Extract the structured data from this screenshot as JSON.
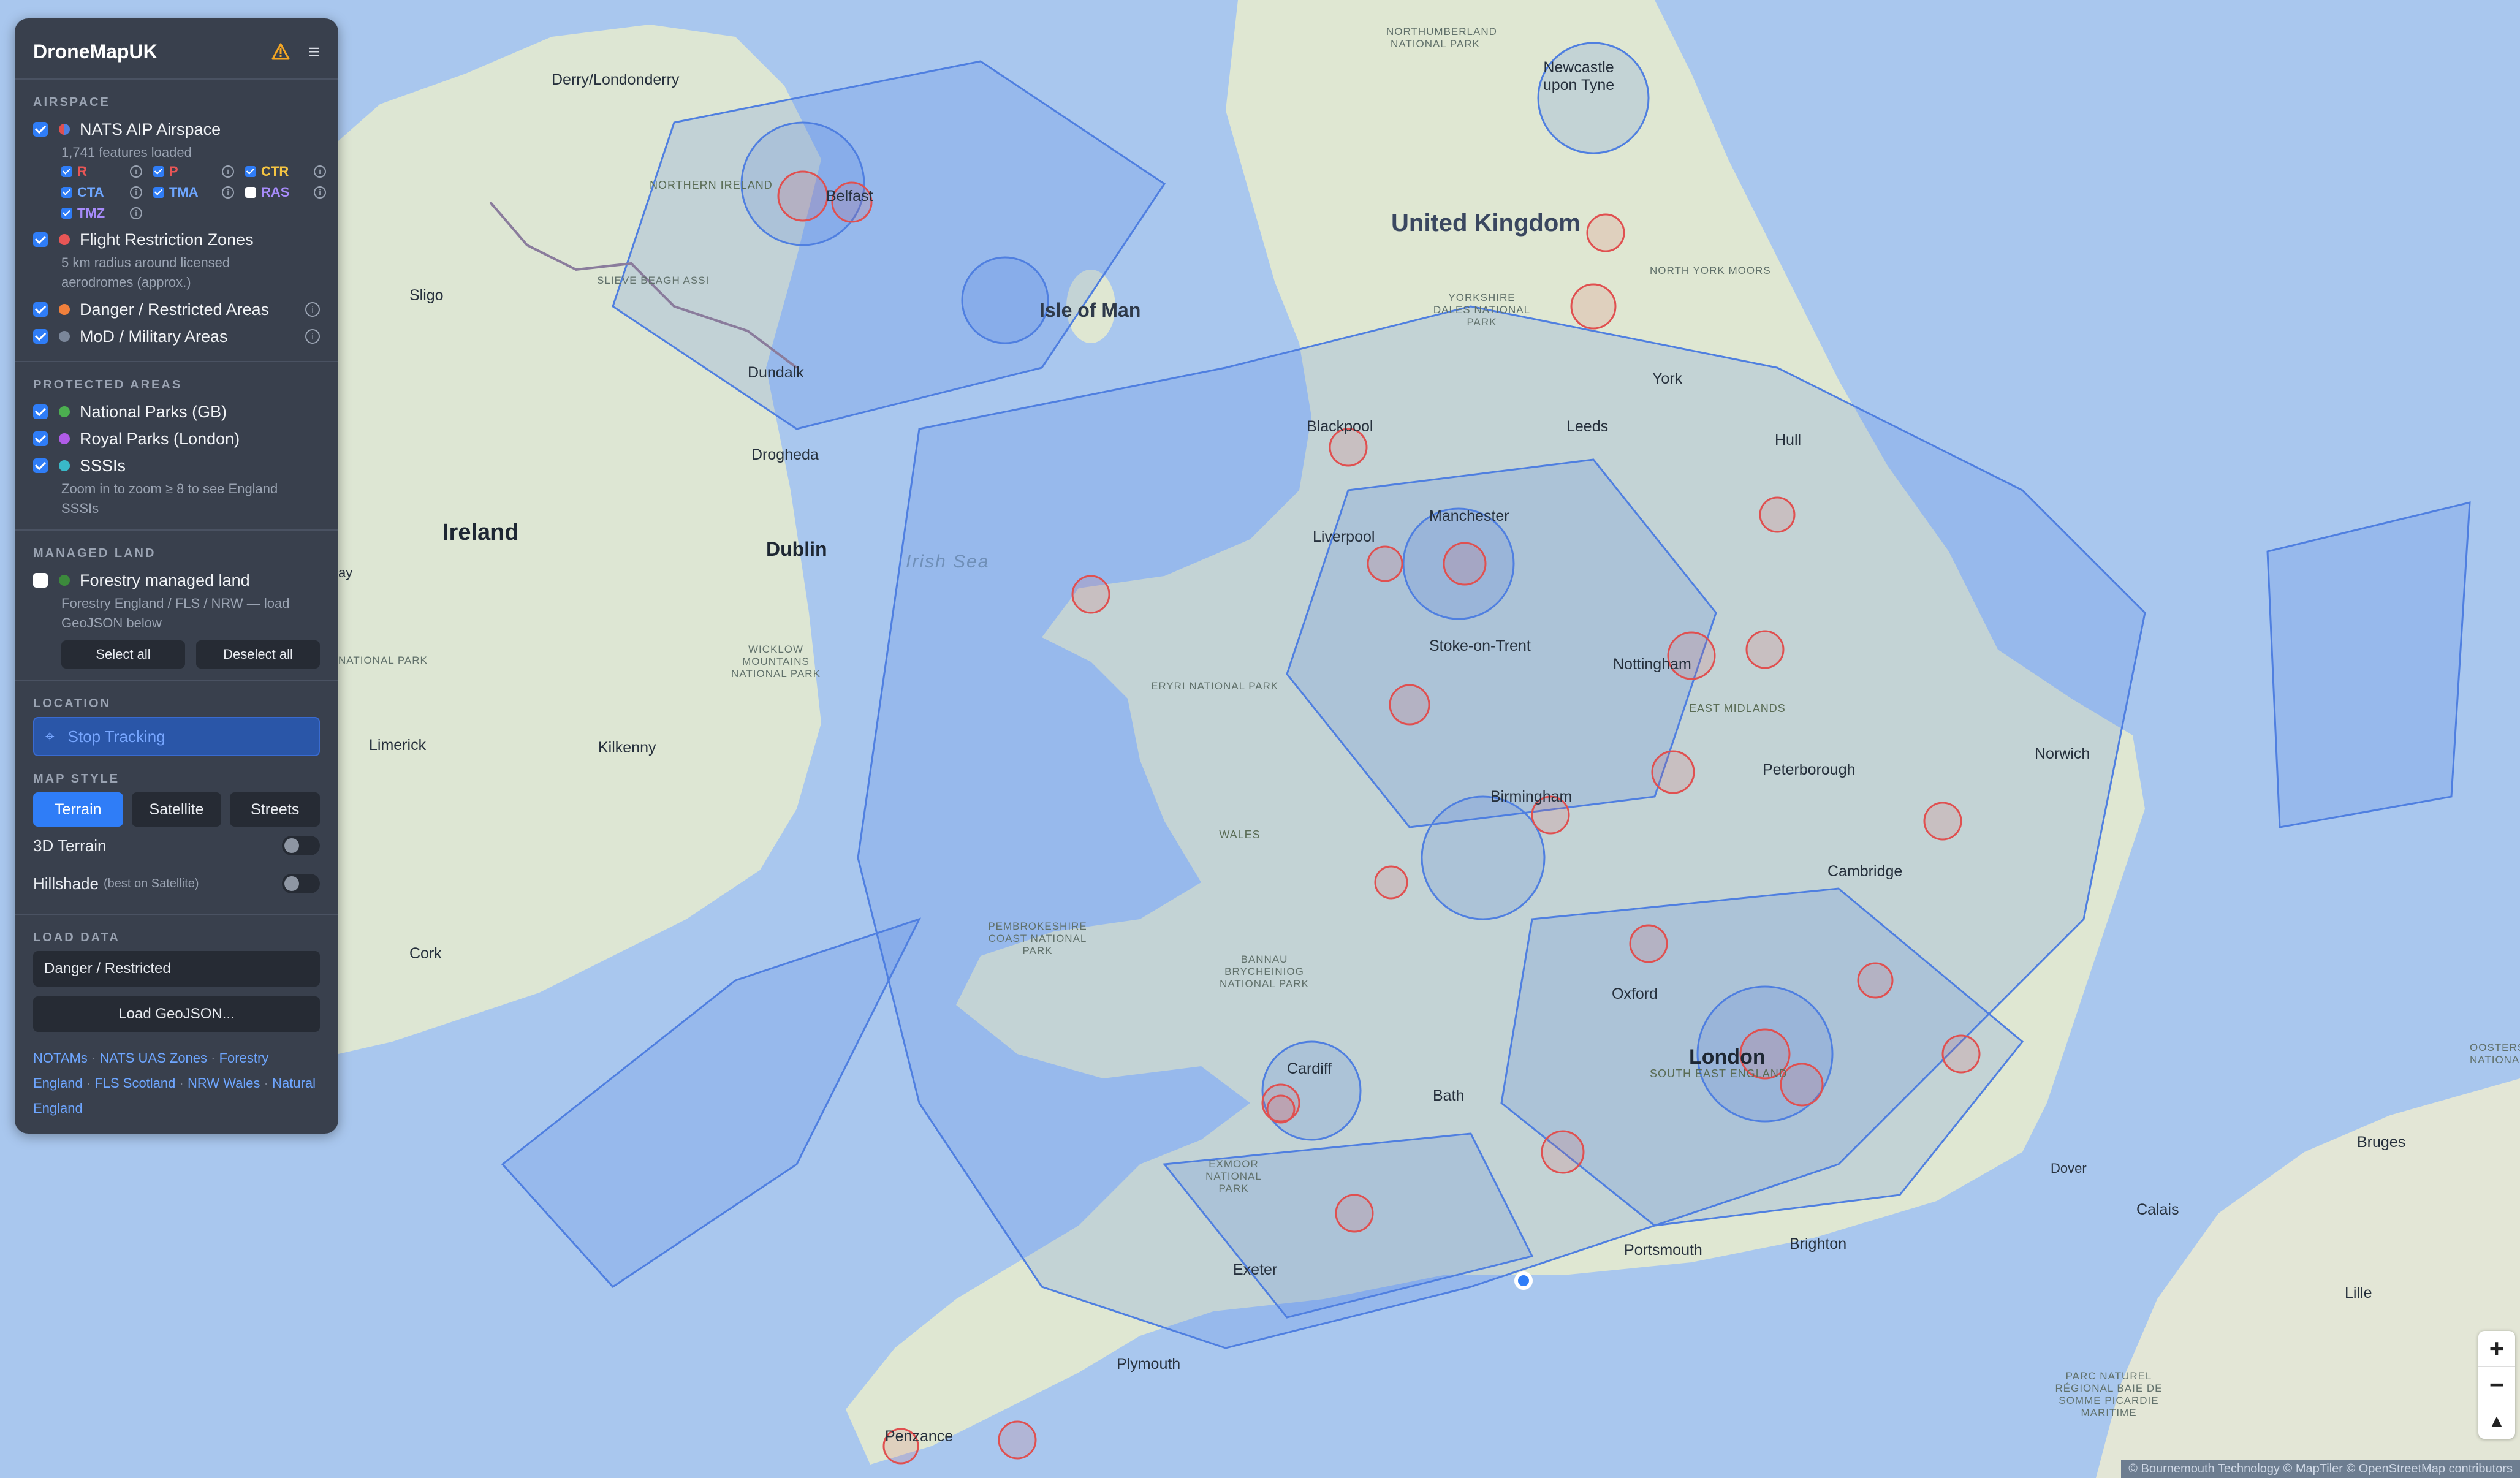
{
  "app": {
    "title": "DroneMapUK"
  },
  "panel": {
    "airspace_header": "AIRSPACE",
    "nats_label": "NATS AIP Airspace",
    "nats_note": "1,741 features loaded",
    "sub_r": "R",
    "sub_p": "P",
    "sub_ctr": "CTR",
    "sub_cta": "CTA",
    "sub_tma": "TMA",
    "sub_ras": "RAS",
    "sub_tmz": "TMZ",
    "frz_label": "Flight Restriction Zones",
    "frz_note_1": "5 km radius around licensed",
    "frz_note_2": "aerodromes (approx.)",
    "danger_label": "Danger / Restricted Areas",
    "mod_label": "MoD / Military Areas",
    "protected_header": "PROTECTED AREAS",
    "national_parks_label": "National Parks (GB)",
    "royal_parks_label": "Royal Parks (London)",
    "sssi_label": "SSSIs",
    "sssi_note_1": "Zoom in to zoom ≥ 8 to see England",
    "sssi_note_2": "SSSIs",
    "managed_header": "MANAGED LAND",
    "forestry_label": "Forestry managed land",
    "forestry_note_1": "Forestry England / FLS / NRW — load",
    "forestry_note_2": "GeoJSON below",
    "select_all": "Select all",
    "deselect_all": "Deselect all",
    "location_header": "LOCATION",
    "tracking_label": "Stop Tracking",
    "style_header": "MAP STYLE",
    "style_terrain": "Terrain",
    "style_satellite": "Satellite",
    "style_streets": "Streets",
    "terrain3d_label": "3D Terrain",
    "hillshade_label": "Hillshade",
    "hillshade_note": "(best on Satellite)",
    "load_header": "LOAD DATA",
    "load_select": "Danger / Restricted",
    "load_button": "Load GeoJSON...",
    "link_notams": "NOTAMs",
    "link_nats": "NATS UAS Zones",
    "link_forestry": "Forestry England",
    "link_fls": "FLS Scotland",
    "link_nrw": "NRW Wales",
    "link_ne": "Natural England"
  },
  "map": {
    "places": {
      "uk": "United Kingdom",
      "ireland": "Ireland",
      "london": "London",
      "dublin": "Dublin",
      "isle_of_man": "Isle of Man",
      "irish_sea": "Irish Sea",
      "derry": "Derry/Londonderry",
      "belfast": "Belfast",
      "n_ireland": "NORTHERN IRELAND",
      "sligo": "Sligo",
      "dundalk": "Dundalk",
      "drogheda": "Drogheda",
      "limerick": "Limerick",
      "kilkenny": "Kilkenny",
      "cork": "Cork",
      "newcastle": "Newcastle upon Tyne",
      "york": "York",
      "hull": "Hull",
      "leeds": "Leeds",
      "blackpool": "Blackpool",
      "manchester": "Manchester",
      "liverpool": "Liverpool",
      "stoke": "Stoke-on-Trent",
      "nottingham": "Nottingham",
      "east_midlands": "EAST MIDLANDS",
      "birmingham": "Birmingham",
      "peterborough": "Peterborough",
      "norwich": "Norwich",
      "cambridge": "Cambridge",
      "wales": "WALES",
      "oxford": "Oxford",
      "cardiff": "Cardiff",
      "bath": "Bath",
      "se_england": "SOUTH EAST ENGLAND",
      "exeter": "Exeter",
      "plymouth": "Plymouth",
      "portsmouth": "Portsmouth",
      "brighton": "Brighton",
      "penzance": "Penzance",
      "dover": "Dover",
      "calais": "Calais",
      "bruges": "Bruges",
      "lille": "Lille",
      "northumberland": "NORTHUMBERLAND NATIONAL PARK",
      "yorkshire_dales": "YORKSHIRE DALES NATIONAL PARK",
      "nym": "NORTH YORK MOORS",
      "eryri": "ERYRI NATIONAL PARK",
      "pembrokeshire": "PEMBROKESHIRE COAST NATIONAL PARK",
      "bannau": "BANNAU BRYCHEINIOG NATIONAL PARK",
      "exmoor": "EXMOOR NATIONAL PARK",
      "wicklow": "WICKLOW MOUNTAINS NATIONAL PARK",
      "slieve": "SLIEVE BEAGH ASSI",
      "parc_naturel": "PARC NATUREL RÉGIONAL BAIE DE SOMME PICARDIE MARITIME",
      "oosters": "OOSTERS NATIONA",
      "ay": "ay",
      "national_park_left": "NATIONAL PARK"
    },
    "attribution": "© Bournemouth Technology  © MapTiler  © OpenStreetMap contributors",
    "zoom_in": "+",
    "zoom_out": "−",
    "compass": "▲"
  }
}
